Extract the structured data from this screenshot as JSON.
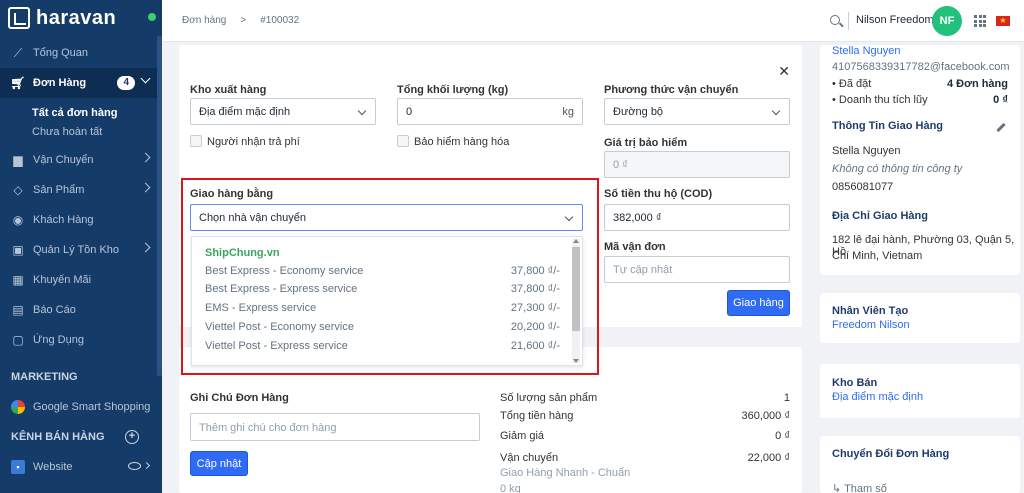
{
  "app": {
    "brand": "haravan"
  },
  "sidebar": {
    "items": [
      {
        "label": "Tổng Quan",
        "icon": "trend-icon"
      },
      {
        "label": "Đơn Hàng",
        "icon": "cart-icon",
        "badge": "4"
      },
      {
        "label": "Vận Chuyển",
        "icon": "truck-icon"
      },
      {
        "label": "Sản Phẩm",
        "icon": "tag-icon"
      },
      {
        "label": "Khách Hàng",
        "icon": "user-icon"
      },
      {
        "label": "Quản Lý Tồn Kho",
        "icon": "box-icon"
      },
      {
        "label": "Khuyến Mãi",
        "icon": "gift-icon"
      },
      {
        "label": "Báo Cáo",
        "icon": "report-icon"
      },
      {
        "label": "Ứng Dụng",
        "icon": "apps-icon"
      }
    ],
    "sub_items": [
      "Tất cả đơn hàng",
      "Chưa hoàn tất"
    ],
    "marketing_label": "MARKETING",
    "google_label": "Google Smart Shopping",
    "channels_label": "KÊNH BÁN HÀNG",
    "website_label": "Website"
  },
  "topbar": {
    "breadcrumb": [
      "Đơn hàng",
      ">",
      "#100032"
    ],
    "user_name": "Nilson Freedome",
    "avatar_initials": "NF"
  },
  "shipping_form": {
    "warehouse_label": "Kho xuất hàng",
    "warehouse_value": "Địa điểm mặc định",
    "weight_label": "Tổng khối lượng (kg)",
    "weight_value": "0",
    "weight_unit": "kg",
    "method_label": "Phương thức vận chuyển",
    "method_value": "Đường bộ",
    "receiver_pays_label": "Người nhận trả phí",
    "insurance_label": "Bảo hiểm hàng hóa",
    "insurance_value_label": "Giá trị bảo hiểm",
    "insurance_value": "0 ₫",
    "carrier_label": "Giao hàng bằng",
    "carrier_placeholder": "Chọn nhà vận chuyển",
    "cod_label": "Số tiền thu hộ (COD)",
    "cod_value": "382,000 ₫",
    "tracking_label": "Mã vận đơn",
    "tracking_placeholder": "Tự cập nhật",
    "submit_label": "Giao hàng"
  },
  "carrier_dropdown": {
    "group": "ShipChung.vn",
    "options": [
      {
        "name": "Best Express - Economy service",
        "price": "37,800 ₫/-"
      },
      {
        "name": "Best Express - Express service",
        "price": "37,800 ₫/-"
      },
      {
        "name": "EMS - Express service",
        "price": "27,300 ₫/-"
      },
      {
        "name": "Viettel Post - Economy service",
        "price": "20,200 ₫/-"
      },
      {
        "name": "Viettel Post - Express service",
        "price": "21,600 ₫/-"
      }
    ]
  },
  "order_summary": {
    "note_label": "Ghi Chú Đơn Hàng",
    "note_placeholder": "Thêm ghi chú cho đơn hàng",
    "update_label": "Cập nhật",
    "rows": [
      {
        "label": "Số lượng sản phẩm",
        "value": "1"
      },
      {
        "label": "Tổng tiền hàng",
        "value": "360,000 ₫"
      },
      {
        "label": "Giảm giá",
        "value": "0 ₫"
      },
      {
        "label": "Vận chuyển",
        "value": "22,000 ₫"
      }
    ],
    "shipping_detail": "Giao Hàng Nhanh - Chuẩn",
    "shipping_weight": "0 kg"
  },
  "customer": {
    "name": "Stella Nguyen",
    "email": "4107568339317782@facebook.com",
    "orders_label": "• Đã đặt",
    "orders_value": "4 Đơn hàng",
    "revenue_label": "• Doanh thu tích lũy",
    "revenue_value": "0 ₫",
    "shipping_info_title": "Thông Tin Giao Hàng",
    "ship_name": "Stella Nguyen",
    "ship_company": "Không có thông tin công ty",
    "ship_phone": "0856081077",
    "address_title": "Địa Chỉ Giao Hàng",
    "address_line1": "182 lê đại hành, Phường 03, Quận 5, Hồ",
    "address_line2": "Chí Minh, Vietnam"
  },
  "staff": {
    "title": "Nhân Viên Tạo",
    "value": "Freedom Nilson"
  },
  "store": {
    "title": "Kho Bán",
    "value": "Địa điểm mặc định"
  },
  "convert": {
    "title": "Chuyển Đổi Đơn Hàng",
    "param_label": "Tham số"
  }
}
